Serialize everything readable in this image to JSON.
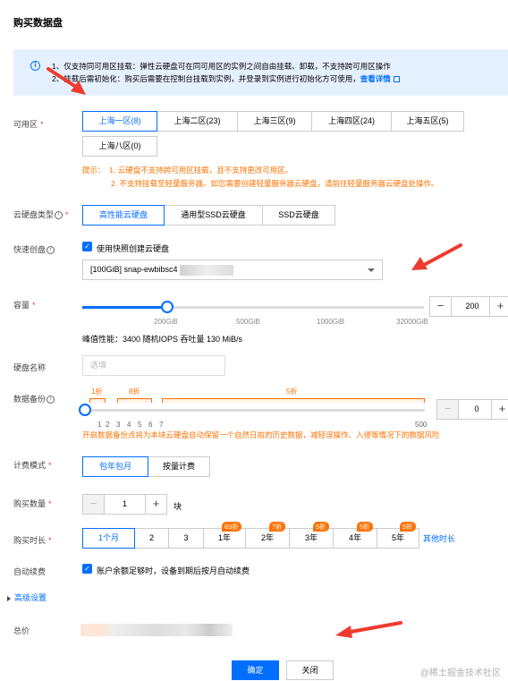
{
  "page": {
    "title": "购买数据盘"
  },
  "notice": {
    "line1": "1、仅支持同可用区挂载：弹性云硬盘可在同可用区的实例之间自由挂载、卸载，不支持跨可用区操作",
    "line2": "2、挂载后需初始化：购买后需要在控制台挂载到实例，并登录到实例进行初始化方可使用，",
    "link": "查看详情"
  },
  "zone": {
    "label": "可用区",
    "options": [
      "上海一区(8)",
      "上海二区(23)",
      "上海三区(9)",
      "上海四区(24)",
      "上海五区(5)",
      "上海八区(0)"
    ],
    "selected": "上海一区(8)",
    "tip_prefix": "提示：",
    "tip1": "1. 云硬盘不支持跨可用区挂载，且不支持更改可用区。",
    "tip2": "2. 不支持挂载至轻量服务器。如您需要创建轻量服务器云硬盘，请前往轻量服务器云硬盘处操作。"
  },
  "disk_type": {
    "label": "云硬盘类型",
    "options": [
      "高性能云硬盘",
      "通用型SSD云硬盘",
      "SSD云硬盘"
    ],
    "selected": "高性能云硬盘"
  },
  "snapshot": {
    "label": "快速创盘",
    "checkbox_label": "使用快照创建云硬盘",
    "checked": true,
    "select_value": "[100GiB] snap-ewbibsc4"
  },
  "capacity": {
    "label": "容量",
    "ticks": [
      "200GiB",
      "500GiB",
      "1000GiB",
      "32000GiB"
    ],
    "value": "200",
    "perf": "峰值性能：3400 随机IOPS 吞吐量 130 MiB/s"
  },
  "disk_name": {
    "label": "硬盘名称",
    "placeholder": "选填"
  },
  "backup": {
    "label": "数据备份",
    "discounts": [
      "1折",
      "8折",
      "5折"
    ],
    "ticks": [
      "0",
      "1",
      "2",
      "3",
      "4",
      "5",
      "6",
      "7",
      "500"
    ],
    "value": "0",
    "hint": "开启数据备份点将为本块云硬盘自动保留一个自然日前的历史数据，减轻误操作、入侵等情况下的数据风险"
  },
  "billing": {
    "label": "计费模式",
    "options": [
      "包年包月",
      "按量计费"
    ],
    "selected": "包年包月"
  },
  "quantity": {
    "label": "购买数量",
    "value": "1",
    "unit": "块"
  },
  "duration": {
    "label": "购买时长",
    "options": [
      "1个月",
      "2",
      "3",
      "1年",
      "2年",
      "3年",
      "4年",
      "5年"
    ],
    "badges": [
      "83折",
      "7折",
      "5折",
      "5折",
      "5折"
    ],
    "selected": "1个月",
    "other": "其他时长"
  },
  "auto_renew": {
    "label": "自动续费",
    "checkbox_label": "账户余额足够时，设备到期后按月自动续费",
    "checked": true
  },
  "advanced": {
    "label": "高级设置"
  },
  "total": {
    "label": "总价"
  },
  "actions": {
    "confirm": "确定",
    "cancel": "关闭"
  },
  "watermark": "@稀土掘金技术社区",
  "colors": {
    "accent": "#006eff",
    "warning": "#ff7200",
    "annotation": "#ee3b2e",
    "required": "#e54545"
  }
}
